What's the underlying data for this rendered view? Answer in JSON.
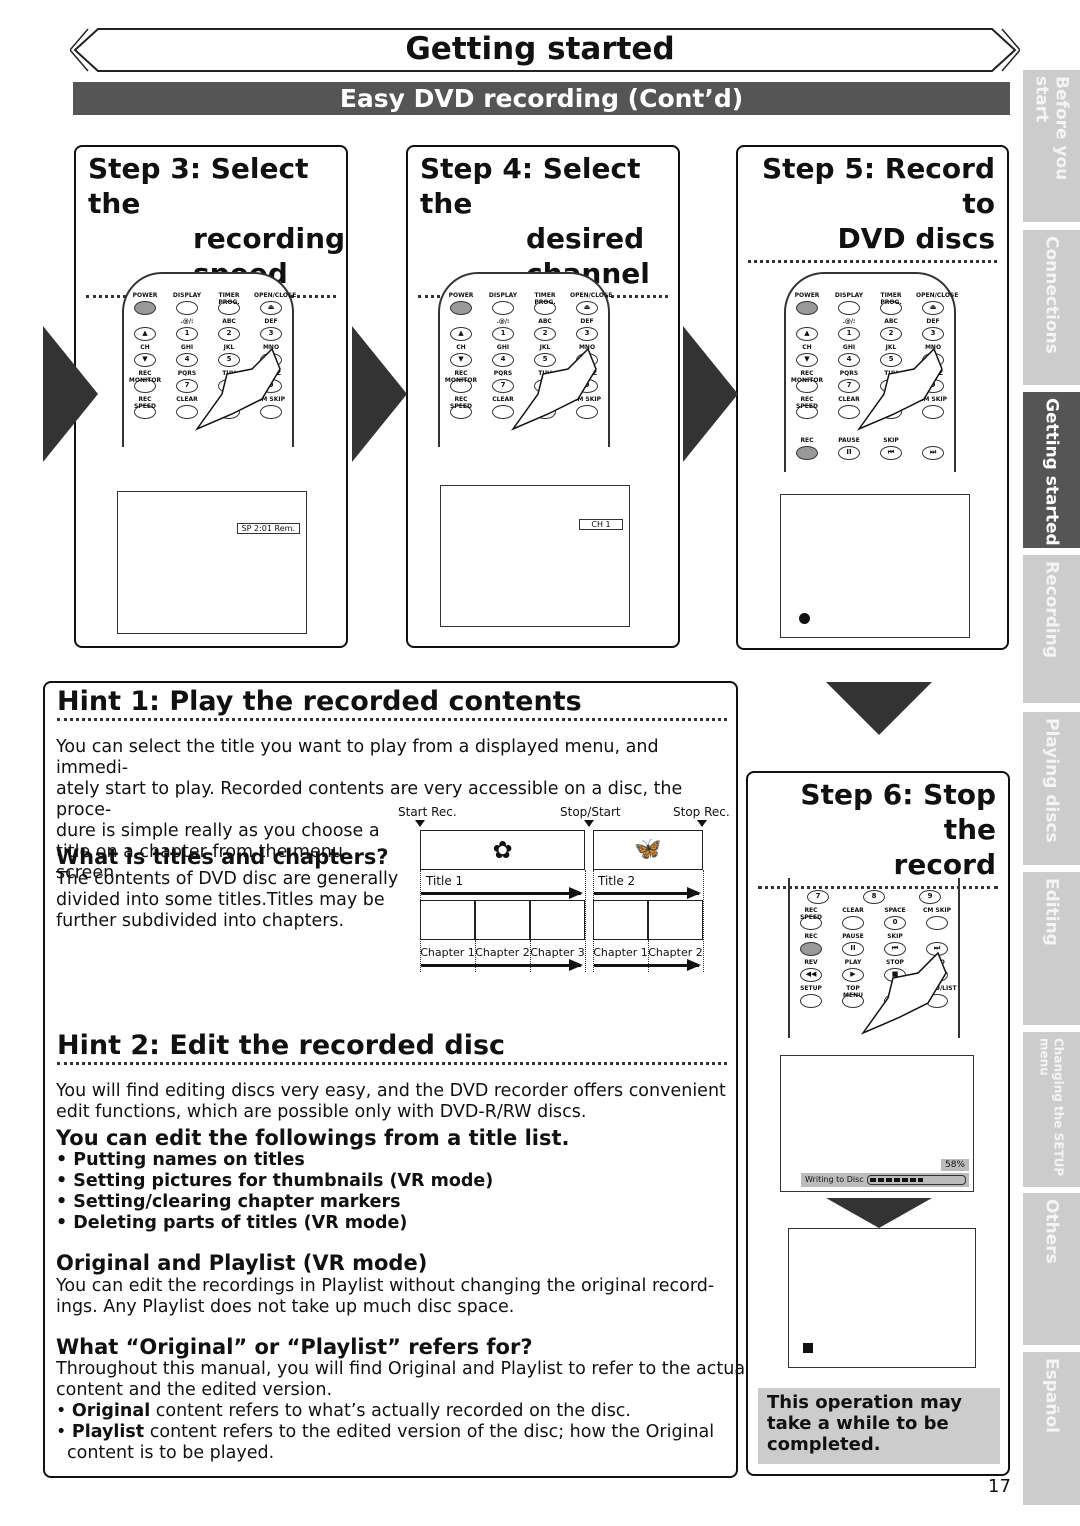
{
  "header": {
    "title": "Getting started",
    "section": "Easy DVD recording (Cont’d)"
  },
  "steps": [
    {
      "title": [
        "Step 3: Select the",
        "recording",
        "speed"
      ],
      "osd": "SP 2:01 Rem."
    },
    {
      "title": [
        "Step 4: Select the",
        "desired",
        "channel"
      ],
      "osd": "CH 1"
    },
    {
      "title": [
        "Step 5: Record to",
        "DVD discs"
      ],
      "osd_icon": "record-dot-icon"
    },
    {
      "title": [
        "Step 6: Stop the",
        "record"
      ],
      "progress": {
        "label": "Writing to Disc",
        "percent_text": "58%",
        "percent": 58
      },
      "osd_icon": "stop-square-icon"
    }
  ],
  "remote": {
    "rows": [
      [
        {
          "t": "POWER",
          "b": "",
          "grey": true
        },
        {
          "t": "DISPLAY",
          "b": ""
        },
        {
          "t": "TIMER PROG.",
          "b": ""
        },
        {
          "t": "OPEN/CLOSE",
          "b": "⏏"
        }
      ],
      [
        {
          "t": "",
          "b": "▲"
        },
        {
          "t": ".@/:",
          "b": "1"
        },
        {
          "t": "ABC",
          "b": "2"
        },
        {
          "t": "DEF",
          "b": "3"
        }
      ],
      [
        {
          "t": "CH",
          "b": "▼"
        },
        {
          "t": "GHI",
          "b": "4"
        },
        {
          "t": "JKL",
          "b": "5"
        },
        {
          "t": "MNO",
          "b": "6"
        }
      ],
      [
        {
          "t": "REC MONITOR",
          "b": ""
        },
        {
          "t": "PQRS",
          "b": "7"
        },
        {
          "t": "TUV",
          "b": "8"
        },
        {
          "t": "WXYZ",
          "b": "9"
        }
      ],
      [
        {
          "t": "REC SPEED",
          "b": ""
        },
        {
          "t": "CLEAR",
          "b": ""
        },
        {
          "t": "SPACE",
          "b": "0"
        },
        {
          "t": "CM SKIP",
          "b": ""
        }
      ]
    ],
    "rec_row": [
      {
        "t": "REC",
        "b": "",
        "grey": true
      },
      {
        "t": "PAUSE",
        "b": "II"
      },
      {
        "t": "SKIP",
        "b": "⏮"
      },
      {
        "t": "",
        "b": "⏭"
      }
    ],
    "step6_rows": [
      [
        {
          "t": "",
          "b": "7"
        },
        {
          "t": "",
          "b": "8"
        },
        {
          "t": "",
          "b": "9"
        }
      ],
      [
        {
          "t": "REC SPEED",
          "b": ""
        },
        {
          "t": "CLEAR",
          "b": ""
        },
        {
          "t": "SPACE",
          "b": "0"
        },
        {
          "t": "CM SKIP",
          "b": ""
        }
      ],
      [
        {
          "t": "REC",
          "b": "",
          "grey": true
        },
        {
          "t": "PAUSE",
          "b": "II"
        },
        {
          "t": "SKIP",
          "b": "⏮"
        },
        {
          "t": "",
          "b": "⏭"
        }
      ],
      [
        {
          "t": "REV",
          "b": "◀◀"
        },
        {
          "t": "PLAY",
          "b": "▶"
        },
        {
          "t": "STOP",
          "b": "■"
        },
        {
          "t": "FWD",
          "b": "▶▶"
        }
      ],
      [
        {
          "t": "SETUP",
          "b": ""
        },
        {
          "t": "TOP MENU",
          "b": ""
        },
        {
          "t": "",
          "b": "▲"
        },
        {
          "t": "MENU/LIST",
          "b": ""
        }
      ]
    ]
  },
  "hint1": {
    "title": "Hint 1: Play the recorded contents",
    "para": [
      "You can select the title you want to play from a displayed menu, and immedi-",
      "ately start to play. Recorded contents are very accessible on a disc, the proce-",
      "dure is simple really as you choose a",
      "title on a chapter from the menu",
      "screen."
    ],
    "sub": "What is titles and chapters?",
    "sub_para": [
      "The contents of DVD disc are generally",
      "divided into some titles.Titles may be",
      "further subdivided into chapters."
    ],
    "diagram": {
      "markers": [
        "Start Rec.",
        "Stop/Start",
        "Stop Rec."
      ],
      "titles": [
        "Title 1",
        "Title 2"
      ],
      "chapters": [
        "Chapter 1",
        "Chapter 2",
        "Chapter 3",
        "Chapter 1",
        "Chapter 2"
      ]
    }
  },
  "hint2": {
    "title": "Hint 2: Edit the recorded disc",
    "para": [
      "You will find editing discs very easy, and the DVD recorder offers convenient",
      "edit functions, which are possible only with DVD-R/RW discs."
    ],
    "sub1": "You can edit the followings from a title list.",
    "bullets": [
      "Putting names on titles",
      "Setting pictures for thumbnails (VR mode)",
      "Setting/clearing chapter markers",
      "Deleting parts of titles (VR mode)"
    ],
    "sub2": "Original and Playlist (VR mode)",
    "sub2_para": [
      "You can edit the recordings in Playlist without changing the original record-",
      "ings. Any Playlist does not take up much disc space."
    ],
    "sub3": "What “Original” or “Playlist” refers for?",
    "sub3_para": [
      "Throughout this manual, you will find Original and Playlist to refer to the actual",
      "content and the edited version."
    ],
    "notes": [
      {
        "b": "Original",
        "t": " content refers to what’s actually recorded on the disc."
      },
      {
        "b": "Playlist",
        "t": " content refers to the edited version of the disc; how the Original"
      }
    ],
    "notes_cont": "content is to be played."
  },
  "note_box": [
    "This operation may",
    "take a while to be",
    "completed."
  ],
  "tabs": [
    {
      "label": "Before you start"
    },
    {
      "label": "Connections"
    },
    {
      "label": "Getting started",
      "active": true
    },
    {
      "label": "Recording"
    },
    {
      "label": "Playing discs"
    },
    {
      "label": "Editing"
    },
    {
      "label": "Changing the SETUP menu"
    },
    {
      "label": "Others"
    },
    {
      "label": "Español"
    }
  ],
  "page_number": "17"
}
